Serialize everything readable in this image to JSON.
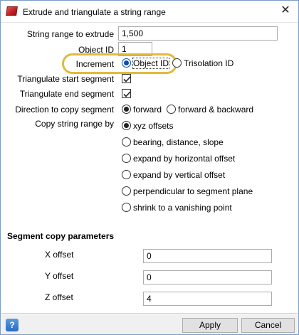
{
  "window": {
    "title": "Extrude and triangulate a string range",
    "close_glyph": "✕"
  },
  "form": {
    "string_range_label": "String range to extrude",
    "string_range_value": "1,500",
    "object_id_label": "Object ID",
    "object_id_value": "1",
    "increment_label": "Increment",
    "increment_options": [
      {
        "label": "Object ID",
        "checked": true
      },
      {
        "label": "Trisolation ID",
        "checked": false
      }
    ],
    "triangulate_start_label": "Triangulate start segment",
    "triangulate_start_checked": true,
    "triangulate_end_label": "Triangulate end segment",
    "triangulate_end_checked": true,
    "direction_label": "Direction to copy segment",
    "direction_options": [
      {
        "label": "forward",
        "checked": true
      },
      {
        "label": "forward & backward",
        "checked": false
      }
    ],
    "copy_by_label": "Copy string range by",
    "copy_by_options": [
      {
        "label": "xyz offsets",
        "checked": true
      },
      {
        "label": "bearing, distance, slope",
        "checked": false
      },
      {
        "label": "expand by horizontal offset",
        "checked": false
      },
      {
        "label": "expand by vertical offset",
        "checked": false
      },
      {
        "label": "perpendicular to segment plane",
        "checked": false
      },
      {
        "label": "shrink to a vanishing point",
        "checked": false
      }
    ]
  },
  "segment": {
    "title": "Segment copy parameters",
    "x_label": "X offset",
    "x_value": "0",
    "y_label": "Y offset",
    "y_value": "0",
    "z_label": "Z offset",
    "z_value": "4"
  },
  "footer": {
    "help_glyph": "?",
    "apply_label": "Apply",
    "cancel_label": "Cancel"
  },
  "colors": {
    "highlight": "#e2b93b",
    "focus": "#0a4fa8"
  }
}
